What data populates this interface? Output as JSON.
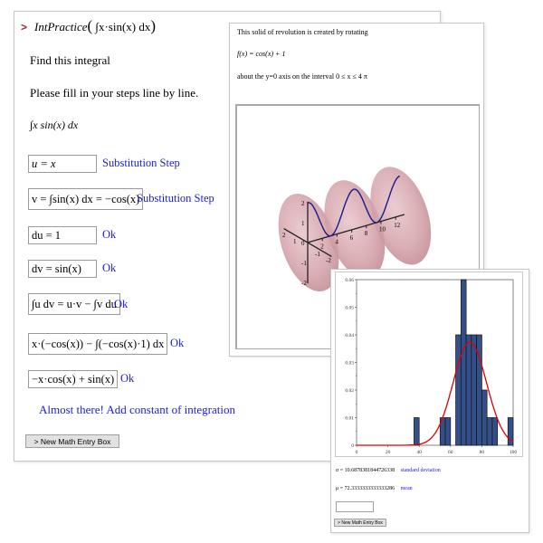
{
  "main_window": {
    "prompt_symbol": ">",
    "command": "IntPractice( ∫ x·sin(x) dx )",
    "command_name": "IntPractice",
    "command_arg": "∫x·sin(x) dx",
    "instruction_1": "Find this integral",
    "instruction_2": "Please fill in your steps line by line.",
    "integral": "∫x sin(x) dx",
    "steps": [
      {
        "input": "u = x",
        "feedback": "Substitution Step"
      },
      {
        "input": "v = ∫sin(x) dx = −cos(x)",
        "feedback": "Substitution Step"
      },
      {
        "input": "du = 1",
        "feedback": "Ok"
      },
      {
        "input": "dv = sin(x)",
        "feedback": "Ok"
      },
      {
        "input": "∫u dv = u·v − ∫v du",
        "feedback": "Ok"
      },
      {
        "input": "x·(−cos(x)) − ∫(−cos(x)·1) dx",
        "feedback": "Ok"
      },
      {
        "input": "−x·cos(x) + sin(x)",
        "feedback": "Ok"
      }
    ],
    "final_message": "Almost there! Add constant of integration",
    "new_box_button": "> New Math Entry Box"
  },
  "solid_window": {
    "line_1": "This solid of revolution is created by rotating",
    "function": "f(x) = cos(x) + 1",
    "line_3": "about the y=0 axis on the interval 0 ≤ x ≤ 4 π",
    "plot": {
      "x_ticks": [
        "2",
        "4",
        "6",
        "8",
        "10",
        "12"
      ],
      "y_ticks": [
        "2",
        "1",
        "0",
        "-1",
        "-2"
      ],
      "z_ticks": [
        "2",
        "1",
        "-1",
        "-2"
      ],
      "surface_color": "#c98a92",
      "curve_color": "#1a1a8c"
    }
  },
  "stats_window": {
    "sigma_label": "σ = 10.6878381844726338",
    "sigma_desc": "standard deviation",
    "mu_label": "μ = 72.3333333333333286",
    "mu_desc": "mean",
    "input_value": "",
    "new_box_button": "> New Math Entry Box"
  },
  "chart_data": {
    "type": "bar",
    "title": "",
    "xlabel": "",
    "ylabel": "",
    "xlim": [
      0,
      100
    ],
    "ylim": [
      0,
      0.06
    ],
    "x_ticks": [
      0,
      20,
      40,
      60,
      80,
      100
    ],
    "y_ticks": [
      0,
      0.01,
      0.02,
      0.03,
      0.04,
      0.05,
      0.06
    ],
    "bar_color": "#34508a",
    "curve_color": "#e00000",
    "bins": [
      {
        "from": 36.67,
        "to": 40.0,
        "density": 0.01
      },
      {
        "from": 53.33,
        "to": 56.67,
        "density": 0.01
      },
      {
        "from": 56.67,
        "to": 60.0,
        "density": 0.01
      },
      {
        "from": 63.33,
        "to": 66.67,
        "density": 0.04
      },
      {
        "from": 66.67,
        "to": 70.0,
        "density": 0.06
      },
      {
        "from": 70.0,
        "to": 73.33,
        "density": 0.04
      },
      {
        "from": 73.33,
        "to": 76.67,
        "density": 0.04
      },
      {
        "from": 76.67,
        "to": 80.0,
        "density": 0.04
      },
      {
        "from": 80.0,
        "to": 83.33,
        "density": 0.02
      },
      {
        "from": 83.33,
        "to": 86.67,
        "density": 0.01
      },
      {
        "from": 86.67,
        "to": 90.0,
        "density": 0.01
      },
      {
        "from": 96.67,
        "to": 100.0,
        "density": 0.01
      }
    ],
    "normal_curve": {
      "mean": 72.33333333333333,
      "sd": 10.687838184472634
    }
  }
}
